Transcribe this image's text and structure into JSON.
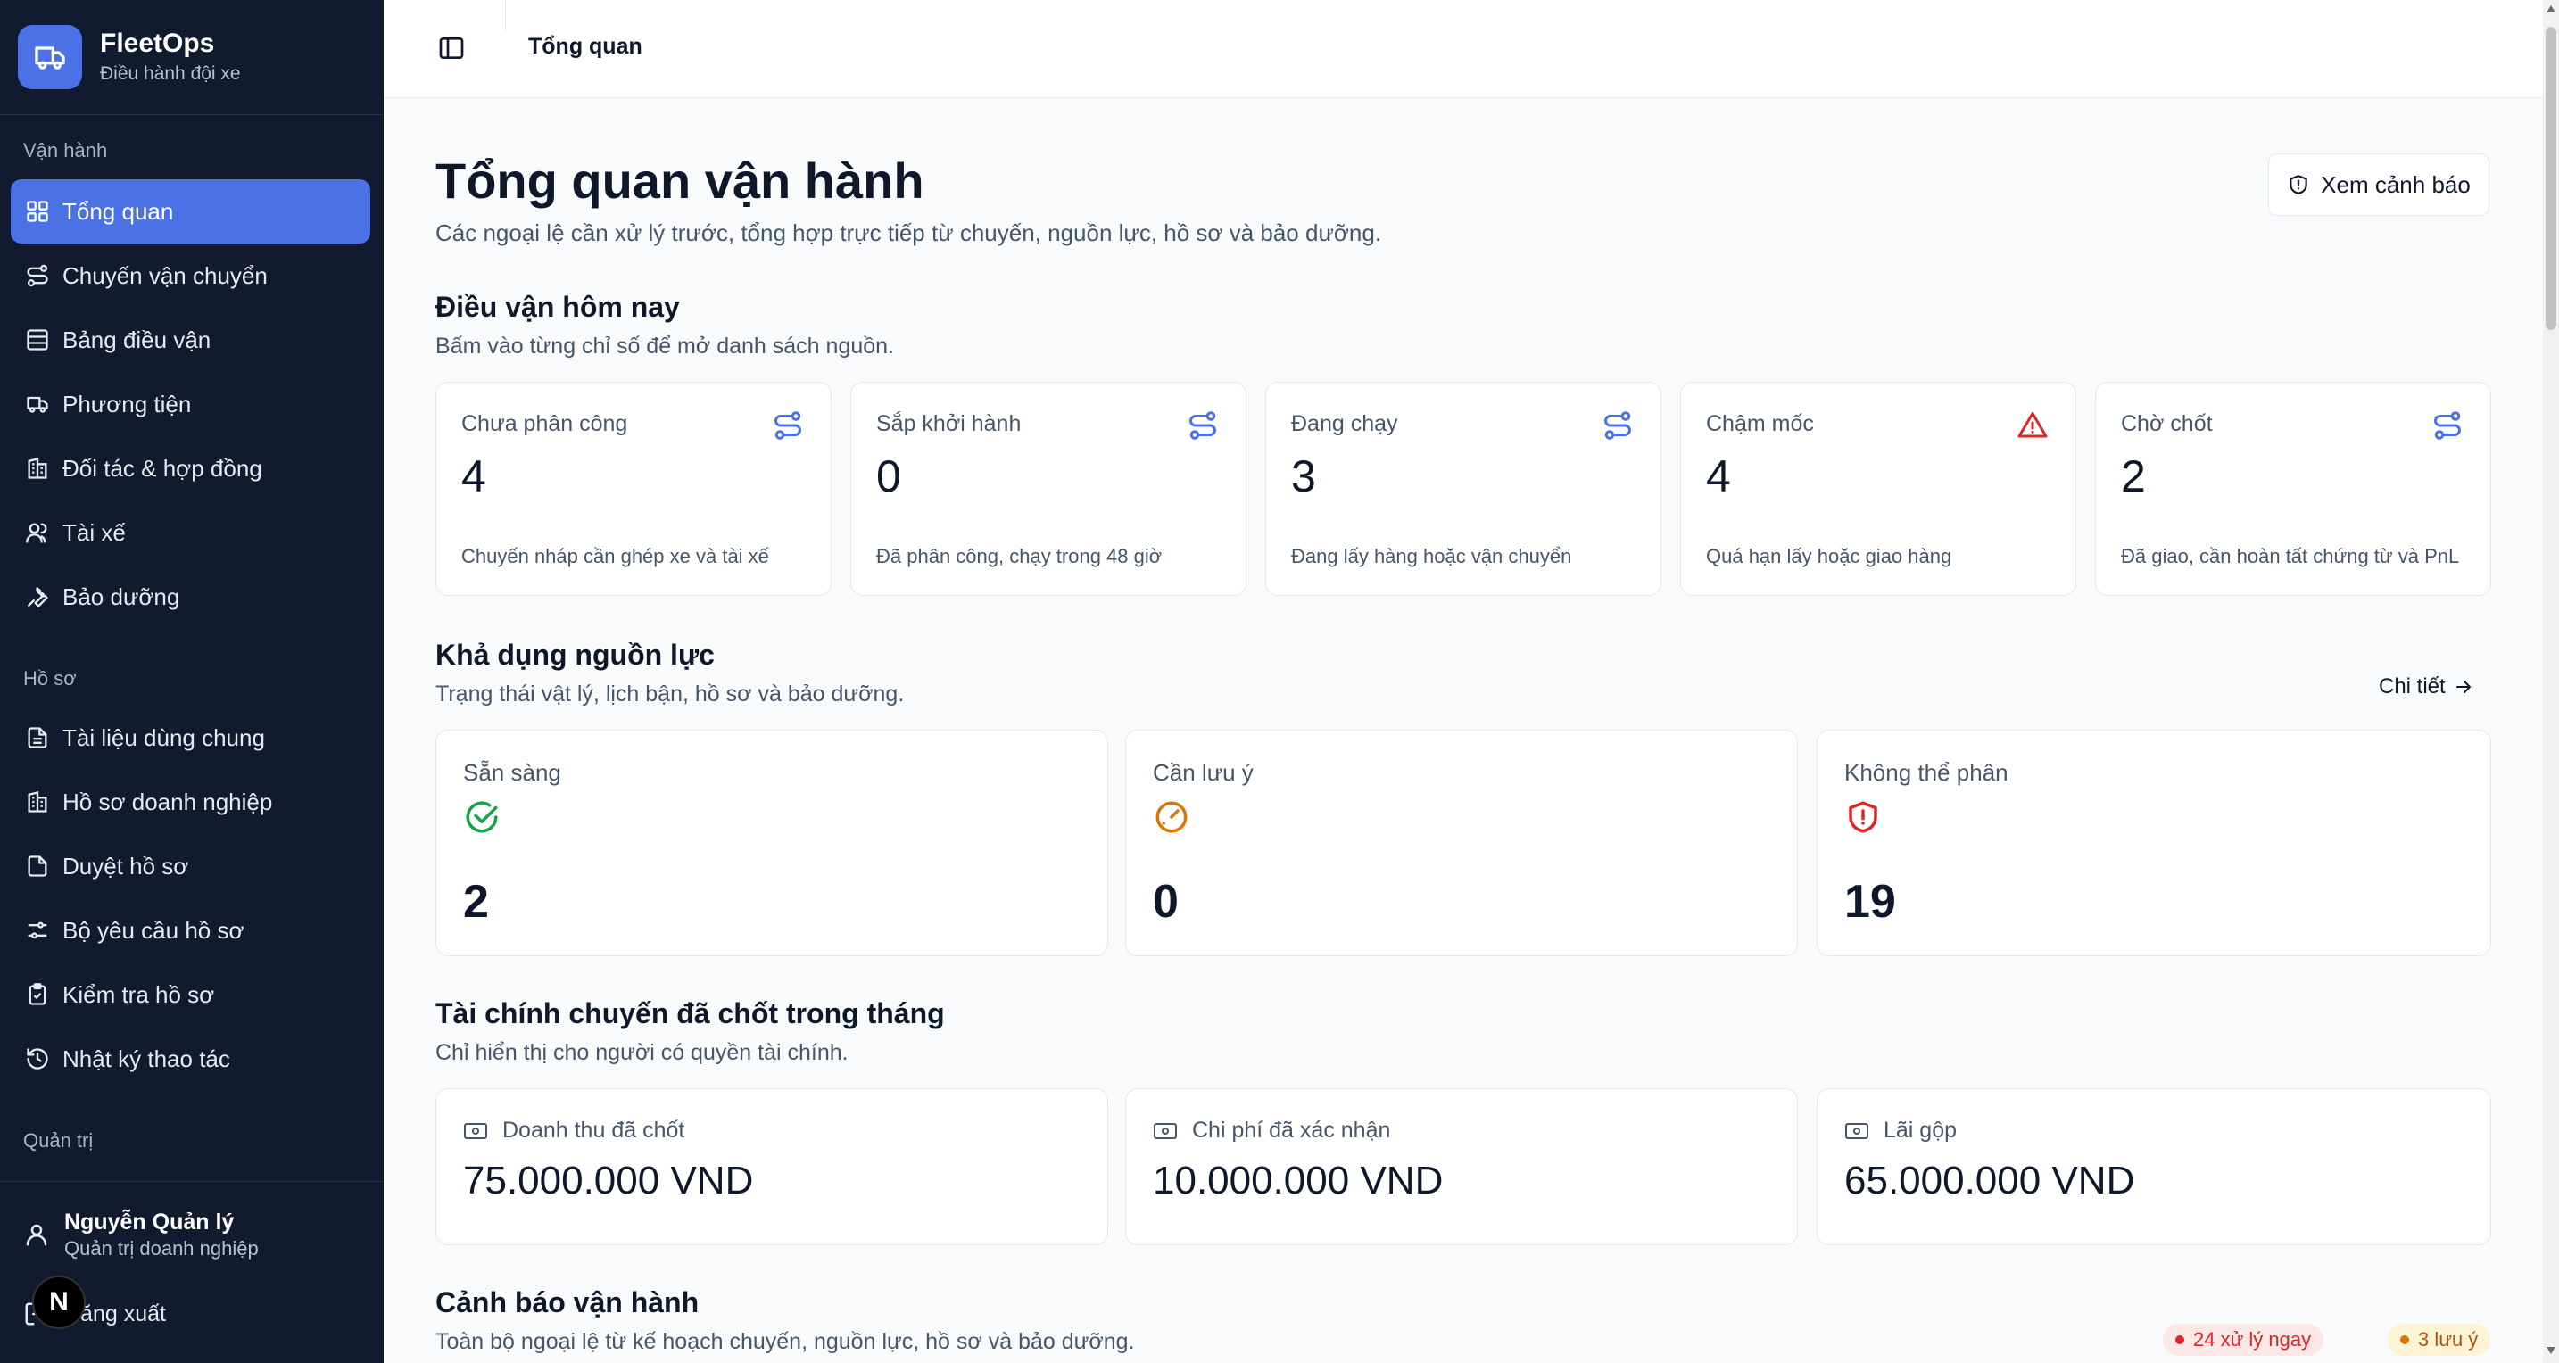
{
  "brand": {
    "name": "FleetOps",
    "subtitle": "Điều hành đội xe"
  },
  "sidebar": {
    "groups": [
      {
        "label": "Vận hành",
        "items": [
          {
            "label": "Tổng quan",
            "icon": "dashboard-grid-icon",
            "active": true
          },
          {
            "label": "Chuyến vận chuyển",
            "icon": "route-icon"
          },
          {
            "label": "Bảng điều vận",
            "icon": "table-icon"
          },
          {
            "label": "Phương tiện",
            "icon": "truck-icon"
          },
          {
            "label": "Đối tác & hợp đồng",
            "icon": "building-icon"
          },
          {
            "label": "Tài xế",
            "icon": "users-icon"
          },
          {
            "label": "Bảo dưỡng",
            "icon": "wrench-icon"
          }
        ]
      },
      {
        "label": "Hồ sơ",
        "items": [
          {
            "label": "Tài liệu dùng chung",
            "icon": "file-text-icon"
          },
          {
            "label": "Hồ sơ doanh nghiệp",
            "icon": "building-icon"
          },
          {
            "label": "Duyệt hồ sơ",
            "icon": "file-check-icon"
          },
          {
            "label": "Bộ yêu cầu hồ sơ",
            "icon": "sliders-icon"
          },
          {
            "label": "Kiểm tra hồ sơ",
            "icon": "clipboard-check-icon"
          },
          {
            "label": "Nhật ký thao tác",
            "icon": "history-icon"
          }
        ]
      },
      {
        "label": "Quản trị",
        "items": []
      }
    ]
  },
  "user": {
    "name": "Nguyễn Quản lý",
    "role": "Quản trị doanh nghiệp",
    "logout": "Đăng xuất"
  },
  "topbar": {
    "title": "Tổng quan"
  },
  "page": {
    "title": "Tổng quan vận hành",
    "subtitle": "Các ngoại lệ cần xử lý trước, tổng hợp trực tiếp từ chuyến, nguồn lực, hồ sơ và bảo dưỡng.",
    "alert_button": "Xem cảnh báo"
  },
  "dispatch": {
    "title": "Điều vận hôm nay",
    "subtitle": "Bấm vào từng chỉ số để mở danh sách nguồn.",
    "cards": [
      {
        "label": "Chưa phân công",
        "value": "4",
        "desc": "Chuyến nháp cần ghép xe và tài xế",
        "icon": "route-icon",
        "color": "#4a72e6"
      },
      {
        "label": "Sắp khởi hành",
        "value": "0",
        "desc": "Đã phân công, chạy trong 48 giờ",
        "icon": "route-icon",
        "color": "#4a72e6"
      },
      {
        "label": "Đang chạy",
        "value": "3",
        "desc": "Đang lấy hàng hoặc vận chuyển",
        "icon": "route-icon",
        "color": "#4a72e6"
      },
      {
        "label": "Chậm mốc",
        "value": "4",
        "desc": "Quá hạn lấy hoặc giao hàng",
        "icon": "warning-triangle-icon",
        "color": "#dc2626"
      },
      {
        "label": "Chờ chốt",
        "value": "2",
        "desc": "Đã giao, cần hoàn tất chứng từ và PnL",
        "icon": "route-icon",
        "color": "#4a72e6"
      }
    ]
  },
  "resources": {
    "title": "Khả dụng nguồn lực",
    "subtitle": "Trạng thái vật lý, lịch bận, hồ sơ và bảo dưỡng.",
    "detail_link": "Chi tiết",
    "cards": [
      {
        "label": "Sẵn sàng",
        "value": "2",
        "icon": "check-circle-icon",
        "color": "#16a34a"
      },
      {
        "label": "Cần lưu ý",
        "value": "0",
        "icon": "gauge-icon",
        "color": "#d97706"
      },
      {
        "label": "Không thể phân",
        "value": "19",
        "icon": "shield-alert-icon",
        "color": "#dc2626"
      }
    ]
  },
  "finance": {
    "title": "Tài chính chuyến đã chốt trong tháng",
    "subtitle": "Chỉ hiển thị cho người có quyền tài chính.",
    "cards": [
      {
        "label": "Doanh thu đã chốt",
        "value": "75.000.000 VND",
        "icon": "banknote-icon"
      },
      {
        "label": "Chi phí đã xác nhận",
        "value": "10.000.000 VND",
        "icon": "banknote-icon"
      },
      {
        "label": "Lãi gộp",
        "value": "65.000.000 VND",
        "icon": "banknote-icon"
      }
    ]
  },
  "alerts": {
    "title": "Cảnh báo vận hành",
    "subtitle": "Toàn bộ ngoại lệ từ kế hoạch chuyến, nguồn lực, hồ sơ và bảo dưỡng.",
    "badges": [
      {
        "label": "24 xử lý ngay",
        "color": "#dc2626",
        "bg": "#fde8e8"
      },
      {
        "label": "3 lưu ý",
        "color": "#b45309",
        "bg": "#fef3d6"
      }
    ]
  }
}
